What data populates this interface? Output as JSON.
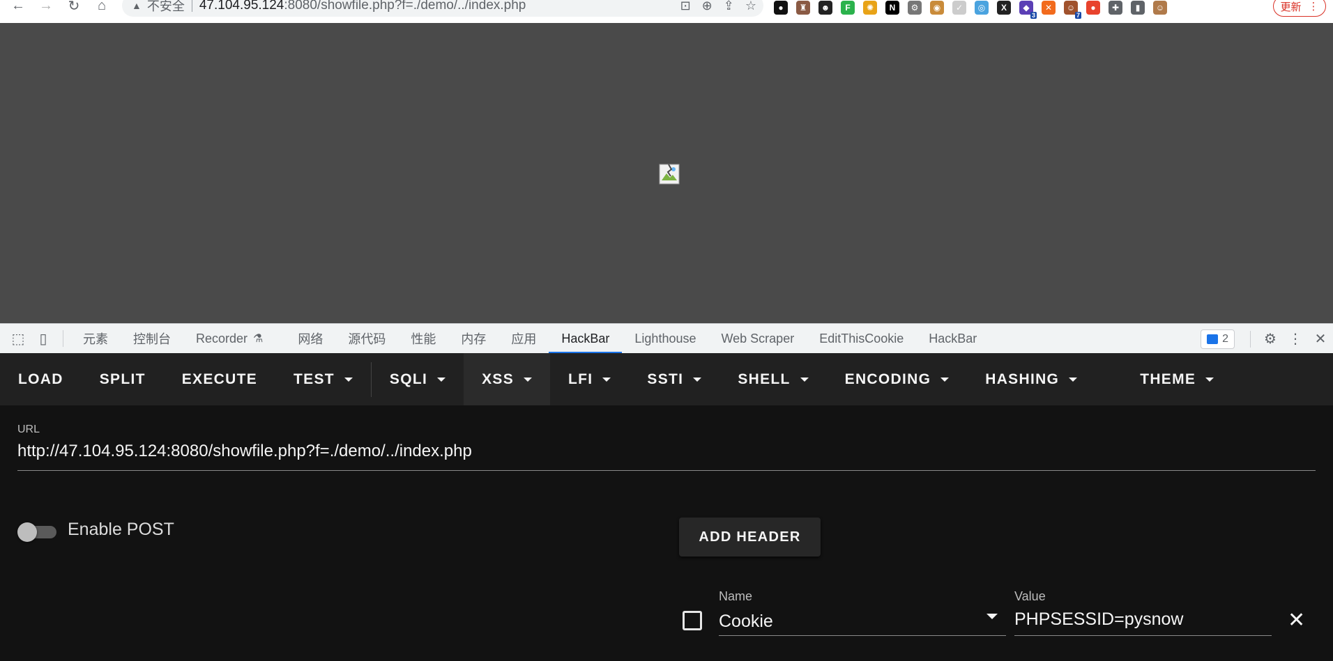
{
  "browser": {
    "insecure_label": "不安全",
    "url_host": "47.104.95.124",
    "url_rest": ":8080/showfile.php?f=./demo/../index.php",
    "update_label": "更新",
    "extensions": [
      {
        "name": "circle-ext",
        "color": "#111111",
        "glyph": "●",
        "badge": ""
      },
      {
        "name": "avatar-ext",
        "color": "#8a5a44",
        "glyph": "♜",
        "badge": ""
      },
      {
        "name": "ghost-ext",
        "color": "#222222",
        "glyph": "☻",
        "badge": ""
      },
      {
        "name": "feedly-ext",
        "color": "#2bb24c",
        "glyph": "F",
        "badge": ""
      },
      {
        "name": "pinwheel-ext",
        "color": "#e8a317",
        "glyph": "✺",
        "badge": ""
      },
      {
        "name": "notion-ext",
        "color": "#000000",
        "glyph": "N",
        "badge": ""
      },
      {
        "name": "gear-ext",
        "color": "#777777",
        "glyph": "⚙",
        "badge": ""
      },
      {
        "name": "cookie-ext",
        "color": "#c98b3a",
        "glyph": "◉",
        "badge": ""
      },
      {
        "name": "check-ext",
        "color": "#cccccc",
        "glyph": "✓",
        "badge": ""
      },
      {
        "name": "globe-ext",
        "color": "#4aa3df",
        "glyph": "◎",
        "badge": ""
      },
      {
        "name": "x-ext",
        "color": "#222222",
        "glyph": "X",
        "badge": ""
      },
      {
        "name": "cube-ext",
        "color": "#5b3fb5",
        "glyph": "◆",
        "badge": "3"
      },
      {
        "name": "orange-ext",
        "color": "#f26b1d",
        "glyph": "✕",
        "badge": ""
      },
      {
        "name": "person-ext",
        "color": "#a0522d",
        "glyph": "☺",
        "badge": "7"
      },
      {
        "name": "red-ext",
        "color": "#e8432d",
        "glyph": "●",
        "badge": ""
      },
      {
        "name": "puzzle-ext",
        "color": "#5f6368",
        "glyph": "✚",
        "badge": ""
      },
      {
        "name": "sidepanel-ext",
        "color": "#5f6368",
        "glyph": "▮",
        "badge": ""
      },
      {
        "name": "profile-ext",
        "color": "#b07a4a",
        "glyph": "☺",
        "badge": ""
      }
    ]
  },
  "devtools": {
    "tabs": [
      "元素",
      "控制台",
      "Recorder",
      "网络",
      "源代码",
      "性能",
      "内存",
      "应用",
      "HackBar",
      "Lighthouse",
      "Web Scraper",
      "EditThisCookie",
      "HackBar"
    ],
    "active_tab_index": 8,
    "issues_count": "2"
  },
  "hackbar": {
    "toolbar": [
      {
        "label": "LOAD",
        "dropdown": false
      },
      {
        "label": "SPLIT",
        "dropdown": false
      },
      {
        "label": "EXECUTE",
        "dropdown": false
      },
      {
        "label": "TEST",
        "dropdown": true
      },
      {
        "label": "SQLI",
        "dropdown": true
      },
      {
        "label": "XSS",
        "dropdown": true
      },
      {
        "label": "LFI",
        "dropdown": true
      },
      {
        "label": "SSTI",
        "dropdown": true
      },
      {
        "label": "SHELL",
        "dropdown": true
      },
      {
        "label": "ENCODING",
        "dropdown": true
      },
      {
        "label": "HASHING",
        "dropdown": true
      },
      {
        "label": "THEME",
        "dropdown": true
      }
    ],
    "url_label": "URL",
    "url_value": "http://47.104.95.124:8080/showfile.php?f=./demo/../index.php",
    "enable_post_label": "Enable POST",
    "enable_post": false,
    "add_header_label": "ADD HEADER",
    "header": {
      "name_label": "Name",
      "name_value": "Cookie",
      "value_label": "Value",
      "value_value": "PHPSESSID=pysnow",
      "enabled": false
    }
  }
}
